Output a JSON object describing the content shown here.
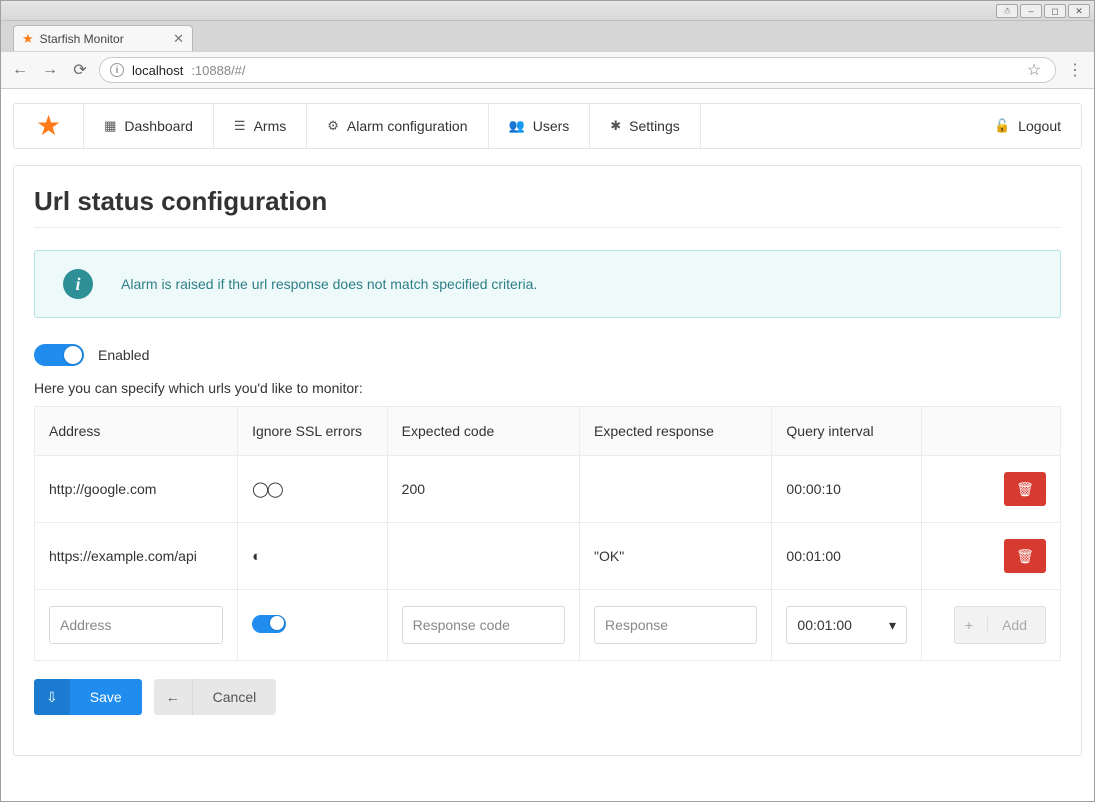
{
  "os": {
    "buttons": [
      "user",
      "min",
      "max",
      "close"
    ]
  },
  "browser": {
    "tab_title": "Starfish Monitor",
    "url_info_icon": "i",
    "url_host": "localhost",
    "url_port_path": ":10888/#/"
  },
  "nav": {
    "items": [
      {
        "icon_name": "dashboard-icon",
        "label": "Dashboard"
      },
      {
        "icon_name": "arms-icon",
        "label": "Arms"
      },
      {
        "icon_name": "alarm-config-icon",
        "label": "Alarm configuration"
      },
      {
        "icon_name": "users-icon",
        "label": "Users"
      },
      {
        "icon_name": "settings-icon",
        "label": "Settings"
      }
    ],
    "logout_label": "Logout"
  },
  "page": {
    "title": "Url status configuration",
    "info_text": "Alarm is raised if the url response does not match specified criteria.",
    "enabled_label": "Enabled",
    "enabled": true,
    "description": "Here you can specify which urls you'd like to monitor:"
  },
  "table": {
    "headers": {
      "address": "Address",
      "ignore_ssl": "Ignore SSL errors",
      "expected_code": "Expected code",
      "expected_response": "Expected response",
      "query_interval": "Query interval"
    },
    "rows": [
      {
        "address": "http://google.com",
        "ignore_ssl_on": false,
        "ssl_glyph": "◯◯",
        "expected_code": "200",
        "expected_response": "",
        "query_interval": "00:00:10"
      },
      {
        "address": "https://example.com/api",
        "ignore_ssl_on": true,
        "ssl_glyph": "◐",
        "expected_code": "",
        "expected_response": "\"OK\"",
        "query_interval": "00:01:00"
      }
    ],
    "new_row": {
      "address_placeholder": "Address",
      "ignore_ssl_on": true,
      "code_placeholder": "Response code",
      "response_placeholder": "Response",
      "interval_default": "00:01:00",
      "add_label": "Add"
    }
  },
  "actions": {
    "save_label": "Save",
    "cancel_label": "Cancel"
  },
  "colors": {
    "accent": "#1f8cee",
    "brand": "#ff7a18",
    "danger": "#d73a2f",
    "info_border": "#b5e3e6",
    "info_bg": "#eef9fa",
    "info_text": "#2e7f87"
  }
}
